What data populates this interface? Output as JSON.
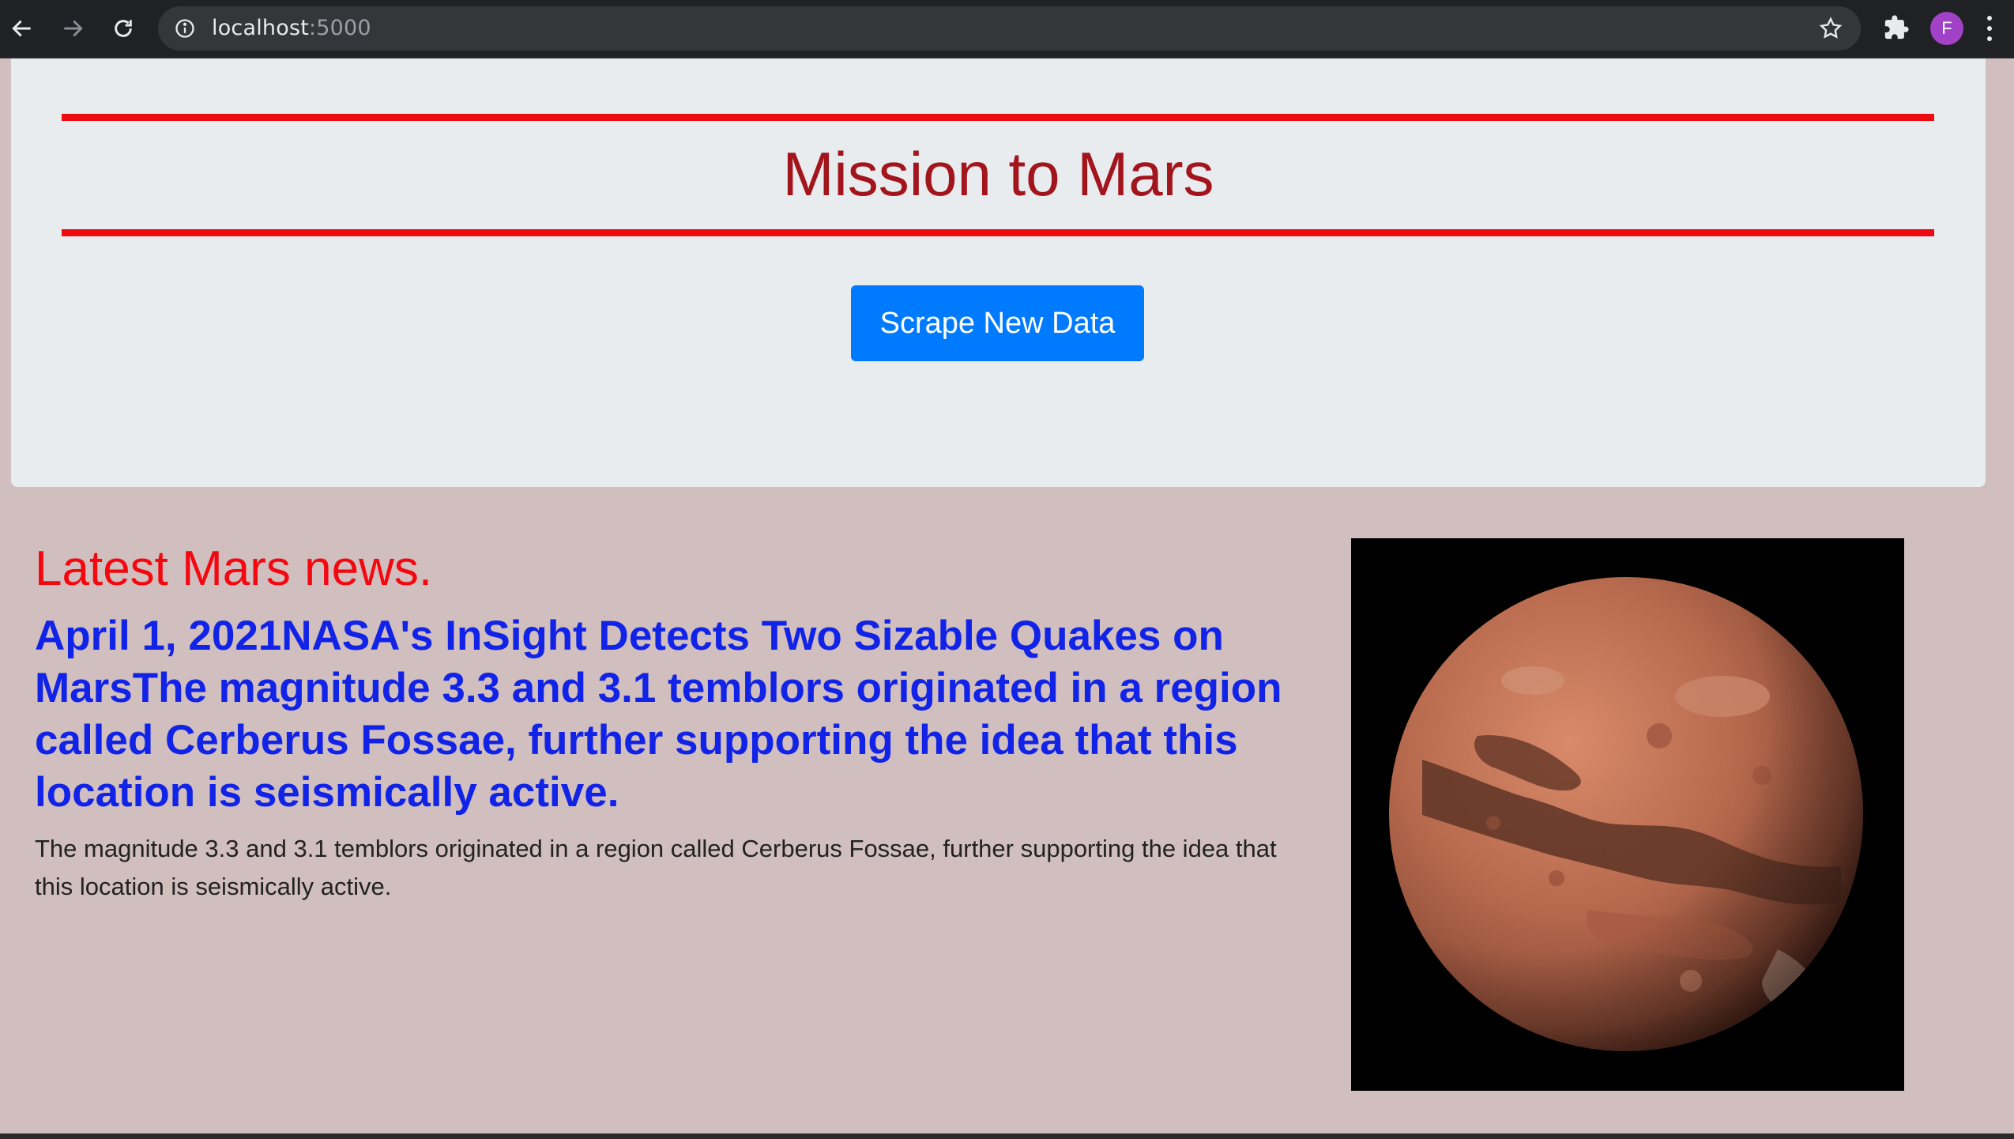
{
  "browser": {
    "url_host": "localhost",
    "url_port": ":5000",
    "profile_initial": "F",
    "icons": {
      "back": "arrow-left-icon",
      "forward": "arrow-right-icon",
      "reload": "reload-icon",
      "site_info": "info-icon",
      "bookmark": "star-icon",
      "extensions": "puzzle-icon",
      "menu": "kebab-menu-icon"
    }
  },
  "header": {
    "title": "Mission to Mars",
    "scrape_button_label": "Scrape New Data",
    "title_color": "#a3151c",
    "rule_color": "#ec0c12",
    "button_color": "#007bff"
  },
  "news": {
    "section_heading": "Latest Mars news.",
    "title": "April 1, 2021NASA's InSight Detects Two Sizable Quakes on MarsThe magnitude 3.3 and 3.1 temblors originated in a region called Cerberus Fossae, further supporting the idea that this location is seismically active.",
    "paragraph": "The magnitude 3.3 and 3.1 temblors originated in a region called Cerberus Fossae, further supporting the idea that this location is seismically active.",
    "heading_color": "#f5070f",
    "title_color": "#1223e8"
  },
  "featured_image": {
    "subject": "mars-planet-image"
  },
  "page_background": "#d1bebe"
}
